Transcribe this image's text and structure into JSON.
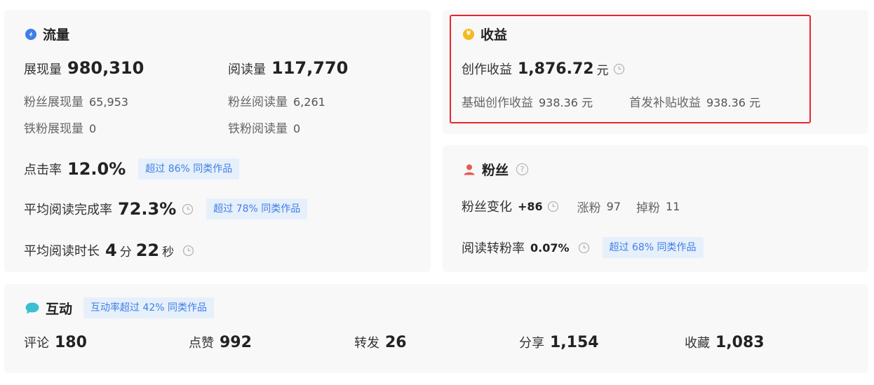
{
  "traffic": {
    "title": "流量",
    "impressions_label": "展现量",
    "impressions_value": "980,310",
    "reads_label": "阅读量",
    "reads_value": "117,770",
    "fan_impressions_label": "粉丝展现量",
    "fan_impressions_value": "65,953",
    "fan_reads_label": "粉丝阅读量",
    "fan_reads_value": "6,261",
    "iron_impressions_label": "铁粉展现量",
    "iron_impressions_value": "0",
    "iron_reads_label": "铁粉阅读量",
    "iron_reads_value": "0",
    "ctr_label": "点击率",
    "ctr_value": "12.0%",
    "ctr_badge": "超过 86% 同类作品",
    "completion_label": "平均阅读完成率",
    "completion_value": "72.3%",
    "completion_badge": "超过 78% 同类作品",
    "duration_label": "平均阅读时长",
    "duration_min": "4",
    "duration_min_unit": "分",
    "duration_sec": "22",
    "duration_sec_unit": "秒"
  },
  "income": {
    "title": "收益",
    "creation_label": "创作收益",
    "creation_value": "1,876.72",
    "creation_unit": "元",
    "base_label": "基础创作收益",
    "base_value": "938.36 元",
    "first_label": "首发补贴收益",
    "first_value": "938.36 元"
  },
  "fans": {
    "title": "粉丝",
    "change_label": "粉丝变化",
    "change_value": "+86",
    "gain_label": "涨粉",
    "gain_value": "97",
    "loss_label": "掉粉",
    "loss_value": "11",
    "conversion_label": "阅读转粉率",
    "conversion_value": "0.07%",
    "conversion_badge": "超过 68% 同类作品"
  },
  "interaction": {
    "title": "互动",
    "badge": "互动率超过 42% 同类作品",
    "comments_label": "评论",
    "comments_value": "180",
    "likes_label": "点赞",
    "likes_value": "992",
    "reposts_label": "转发",
    "reposts_value": "26",
    "shares_label": "分享",
    "shares_value": "1,154",
    "favorites_label": "收藏",
    "favorites_value": "1,083"
  },
  "colors": {
    "accent_blue": "#3f7ee8",
    "highlight_red": "#e8262d",
    "coin_yellow": "#f5b921",
    "fans_red": "#e85a4f",
    "chat_teal": "#3bbfcf"
  },
  "icons": {
    "traffic": "blue-drop-icon",
    "income": "yen-coin-icon",
    "fans": "person-icon",
    "interaction": "chat-bubble-icon",
    "time": "clock-icon",
    "help": "question-circle-icon"
  }
}
